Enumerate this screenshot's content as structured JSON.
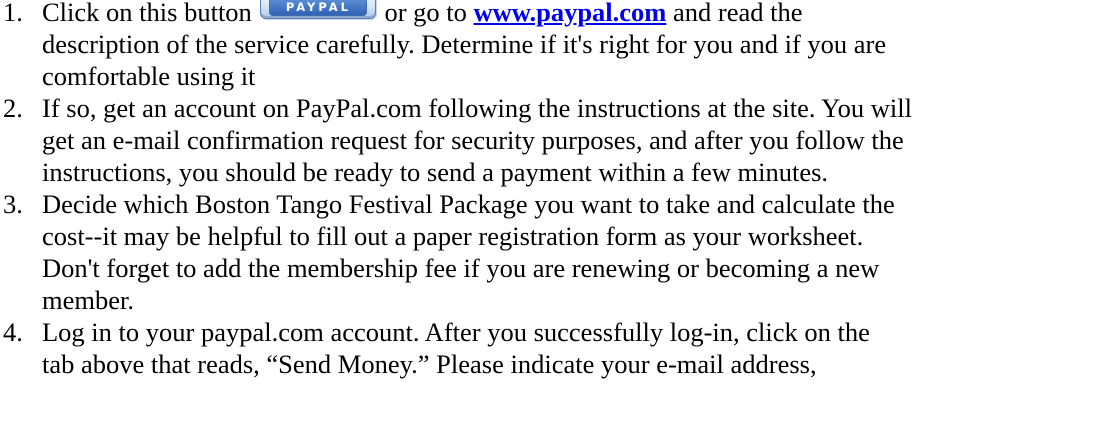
{
  "steps": [
    {
      "number": "1.",
      "line1_before": "Click on this button",
      "button_label": "PAYPAL",
      "line1_middle": "or go to ",
      "link_text": "www.paypal.com",
      "line1_after": " and read the",
      "line2": "description of the service carefully. Determine if it's right for you and if you are",
      "line3": "comfortable using it"
    },
    {
      "number": "2.",
      "lines": [
        "If so, get an account on PayPal.com following the instructions at the site. You will",
        "get an e-mail confirmation request for security purposes, and after you follow the",
        "instructions, you should be ready to send a payment within a few minutes."
      ]
    },
    {
      "number": "3.",
      "lines": [
        "Decide which Boston Tango Festival Package you want to take and calculate the",
        "cost--it may be helpful to fill out a paper registration form as your worksheet.",
        "Don't forget to add the membership fee if you are renewing or becoming a new",
        "member."
      ]
    },
    {
      "number": "4.",
      "lines": [
        "Log in to your paypal.com account.  After you successfully log-in, click on the",
        "tab above that reads, “Send Money.”  Please indicate your e-mail address,"
      ]
    }
  ],
  "colors": {
    "link": "#0000ee",
    "button_blue": "#2f63b4"
  },
  "icons": {
    "paypal_button": "paypal-button-icon"
  }
}
